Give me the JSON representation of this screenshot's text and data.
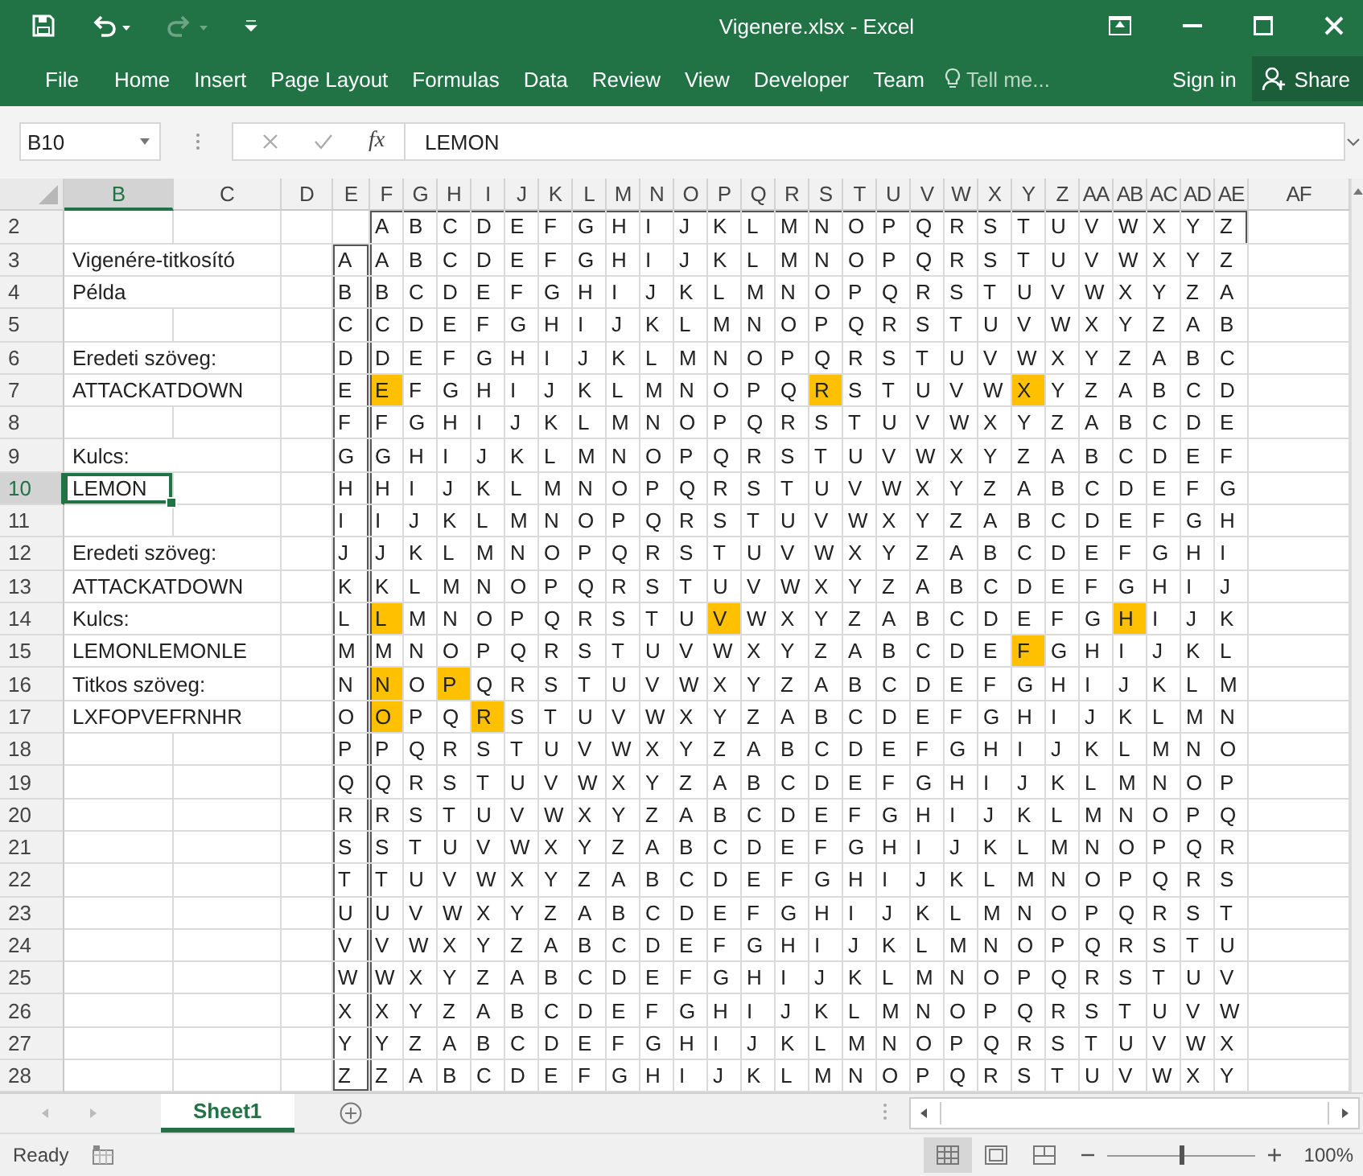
{
  "window": {
    "title": "Vigenere.xlsx - Excel"
  },
  "quick_access": [
    {
      "kind": "save",
      "disabled": false
    },
    {
      "kind": "undo",
      "disabled": false
    },
    {
      "kind": "redo",
      "disabled": true
    }
  ],
  "ribbon_tabs": [
    "File",
    "Home",
    "Insert",
    "Page Layout",
    "Formulas",
    "Data",
    "Review",
    "View",
    "Developer",
    "Team"
  ],
  "tell_me": {
    "placeholder": "Tell me..."
  },
  "sign_in": "Sign in",
  "share": "Share",
  "name_box": "B10",
  "formula_bar": {
    "fx": "fx",
    "value": "LEMON"
  },
  "columns": [
    "B",
    "C",
    "D",
    "E",
    "F",
    "G",
    "H",
    "I",
    "J",
    "K",
    "L",
    "M",
    "N",
    "O",
    "P",
    "Q",
    "R",
    "S",
    "T",
    "U",
    "V",
    "W",
    "X",
    "Y",
    "Z",
    "AA",
    "AB",
    "AC",
    "AD",
    "AE",
    "AF"
  ],
  "rows": [
    {
      "number": "2",
      "letters": [
        "A",
        "B",
        "C",
        "D",
        "E",
        "F",
        "G",
        "H",
        "I",
        "J",
        "K",
        "L",
        "M",
        "N",
        "O",
        "P",
        "Q",
        "R",
        "S",
        "T",
        "U",
        "V",
        "W",
        "X",
        "Y",
        "Z"
      ]
    },
    {
      "number": "3",
      "label": {
        "text": "Vigenére-titkosító",
        "selected": false
      },
      "key": "A",
      "letters": [
        "A",
        "B",
        "C",
        "D",
        "E",
        "F",
        "G",
        "H",
        "I",
        "J",
        "K",
        "L",
        "M",
        "N",
        "O",
        "P",
        "Q",
        "R",
        "S",
        "T",
        "U",
        "V",
        "W",
        "X",
        "Y",
        "Z"
      ]
    },
    {
      "number": "4",
      "label": {
        "text": "Példa",
        "selected": false
      },
      "key": "B",
      "letters": [
        "B",
        "C",
        "D",
        "E",
        "F",
        "G",
        "H",
        "I",
        "J",
        "K",
        "L",
        "M",
        "N",
        "O",
        "P",
        "Q",
        "R",
        "S",
        "T",
        "U",
        "V",
        "W",
        "X",
        "Y",
        "Z",
        "A"
      ]
    },
    {
      "number": "5",
      "key": "C",
      "letters": [
        "C",
        "D",
        "E",
        "F",
        "G",
        "H",
        "I",
        "J",
        "K",
        "L",
        "M",
        "N",
        "O",
        "P",
        "Q",
        "R",
        "S",
        "T",
        "U",
        "V",
        "W",
        "X",
        "Y",
        "Z",
        "A",
        "B"
      ]
    },
    {
      "number": "6",
      "label": {
        "text": "Eredeti szöveg:",
        "selected": false
      },
      "key": "D",
      "letters": [
        "D",
        "E",
        "F",
        "G",
        "H",
        "I",
        "J",
        "K",
        "L",
        "M",
        "N",
        "O",
        "P",
        "Q",
        "R",
        "S",
        "T",
        "U",
        "V",
        "W",
        "X",
        "Y",
        "Z",
        "A",
        "B",
        "C"
      ]
    },
    {
      "number": "7",
      "label": {
        "text": "ATTACKATDOWN",
        "selected": false
      },
      "key": "E",
      "letters": [
        {
          "text": "E",
          "highlighted": true
        },
        "F",
        "G",
        "H",
        "I",
        "J",
        "K",
        "L",
        "M",
        "N",
        "O",
        "P",
        "Q",
        {
          "text": "R",
          "highlighted": true
        },
        "S",
        "T",
        "U",
        "V",
        "W",
        {
          "text": "X",
          "highlighted": true
        },
        "Y",
        "Z",
        "A",
        "B",
        "C",
        "D"
      ]
    },
    {
      "number": "8",
      "key": "F",
      "letters": [
        "F",
        "G",
        "H",
        "I",
        "J",
        "K",
        "L",
        "M",
        "N",
        "O",
        "P",
        "Q",
        "R",
        "S",
        "T",
        "U",
        "V",
        "W",
        "X",
        "Y",
        "Z",
        "A",
        "B",
        "C",
        "D",
        "E"
      ]
    },
    {
      "number": "9",
      "label": {
        "text": "Kulcs:",
        "selected": false
      },
      "key": "G",
      "letters": [
        "G",
        "H",
        "I",
        "J",
        "K",
        "L",
        "M",
        "N",
        "O",
        "P",
        "Q",
        "R",
        "S",
        "T",
        "U",
        "V",
        "W",
        "X",
        "Y",
        "Z",
        "A",
        "B",
        "C",
        "D",
        "E",
        "F"
      ]
    },
    {
      "number": "10",
      "label": {
        "text": "LEMON",
        "selected": true
      },
      "key": "H",
      "letters": [
        "H",
        "I",
        "J",
        "K",
        "L",
        "M",
        "N",
        "O",
        "P",
        "Q",
        "R",
        "S",
        "T",
        "U",
        "V",
        "W",
        "X",
        "Y",
        "Z",
        "A",
        "B",
        "C",
        "D",
        "E",
        "F",
        "G"
      ]
    },
    {
      "number": "11",
      "key": "I",
      "letters": [
        "I",
        "J",
        "K",
        "L",
        "M",
        "N",
        "O",
        "P",
        "Q",
        "R",
        "S",
        "T",
        "U",
        "V",
        "W",
        "X",
        "Y",
        "Z",
        "A",
        "B",
        "C",
        "D",
        "E",
        "F",
        "G",
        "H"
      ]
    },
    {
      "number": "12",
      "label": {
        "text": "Eredeti szöveg:",
        "selected": false
      },
      "key": "J",
      "letters": [
        "J",
        "K",
        "L",
        "M",
        "N",
        "O",
        "P",
        "Q",
        "R",
        "S",
        "T",
        "U",
        "V",
        "W",
        "X",
        "Y",
        "Z",
        "A",
        "B",
        "C",
        "D",
        "E",
        "F",
        "G",
        "H",
        "I"
      ]
    },
    {
      "number": "13",
      "label": {
        "text": "ATTACKATDOWN",
        "selected": false
      },
      "key": "K",
      "letters": [
        "K",
        "L",
        "M",
        "N",
        "O",
        "P",
        "Q",
        "R",
        "S",
        "T",
        "U",
        "V",
        "W",
        "X",
        "Y",
        "Z",
        "A",
        "B",
        "C",
        "D",
        "E",
        "F",
        "G",
        "H",
        "I",
        "J"
      ]
    },
    {
      "number": "14",
      "label": {
        "text": "Kulcs:",
        "selected": false
      },
      "key": "L",
      "letters": [
        {
          "text": "L",
          "highlighted": true
        },
        "M",
        "N",
        "O",
        "P",
        "Q",
        "R",
        "S",
        "T",
        "U",
        {
          "text": "V",
          "highlighted": true
        },
        "W",
        "X",
        "Y",
        "Z",
        "A",
        "B",
        "C",
        "D",
        "E",
        "F",
        "G",
        {
          "text": "H",
          "highlighted": true
        },
        "I",
        "J",
        "K"
      ]
    },
    {
      "number": "15",
      "label": {
        "text": "LEMONLEMONLE",
        "selected": false
      },
      "key": "M",
      "letters": [
        "M",
        "N",
        "O",
        "P",
        "Q",
        "R",
        "S",
        "T",
        "U",
        "V",
        "W",
        "X",
        "Y",
        "Z",
        "A",
        "B",
        "C",
        "D",
        "E",
        {
          "text": "F",
          "highlighted": true
        },
        "G",
        "H",
        "I",
        "J",
        "K",
        "L"
      ]
    },
    {
      "number": "16",
      "label": {
        "text": "Titkos szöveg:",
        "selected": false
      },
      "key": "N",
      "letters": [
        {
          "text": "N",
          "highlighted": true
        },
        "O",
        {
          "text": "P",
          "highlighted": true
        },
        "Q",
        "R",
        "S",
        "T",
        "U",
        "V",
        "W",
        "X",
        "Y",
        "Z",
        "A",
        "B",
        "C",
        "D",
        "E",
        "F",
        "G",
        "H",
        "I",
        "J",
        "K",
        "L",
        "M"
      ]
    },
    {
      "number": "17",
      "label": {
        "text": "LXFOPVEFRNHR",
        "selected": false
      },
      "key": "O",
      "letters": [
        {
          "text": "O",
          "highlighted": true
        },
        "P",
        "Q",
        {
          "text": "R",
          "highlighted": true
        },
        "S",
        "T",
        "U",
        "V",
        "W",
        "X",
        "Y",
        "Z",
        "A",
        "B",
        "C",
        "D",
        "E",
        "F",
        "G",
        "H",
        "I",
        "J",
        "K",
        "L",
        "M",
        "N"
      ]
    },
    {
      "number": "18",
      "key": "P",
      "letters": [
        "P",
        "Q",
        "R",
        "S",
        "T",
        "U",
        "V",
        "W",
        "X",
        "Y",
        "Z",
        "A",
        "B",
        "C",
        "D",
        "E",
        "F",
        "G",
        "H",
        "I",
        "J",
        "K",
        "L",
        "M",
        "N",
        "O"
      ]
    },
    {
      "number": "19",
      "key": "Q",
      "letters": [
        "Q",
        "R",
        "S",
        "T",
        "U",
        "V",
        "W",
        "X",
        "Y",
        "Z",
        "A",
        "B",
        "C",
        "D",
        "E",
        "F",
        "G",
        "H",
        "I",
        "J",
        "K",
        "L",
        "M",
        "N",
        "O",
        "P"
      ]
    },
    {
      "number": "20",
      "key": "R",
      "letters": [
        "R",
        "S",
        "T",
        "U",
        "V",
        "W",
        "X",
        "Y",
        "Z",
        "A",
        "B",
        "C",
        "D",
        "E",
        "F",
        "G",
        "H",
        "I",
        "J",
        "K",
        "L",
        "M",
        "N",
        "O",
        "P",
        "Q"
      ]
    },
    {
      "number": "21",
      "key": "S",
      "letters": [
        "S",
        "T",
        "U",
        "V",
        "W",
        "X",
        "Y",
        "Z",
        "A",
        "B",
        "C",
        "D",
        "E",
        "F",
        "G",
        "H",
        "I",
        "J",
        "K",
        "L",
        "M",
        "N",
        "O",
        "P",
        "Q",
        "R"
      ]
    },
    {
      "number": "22",
      "key": "T",
      "letters": [
        "T",
        "U",
        "V",
        "W",
        "X",
        "Y",
        "Z",
        "A",
        "B",
        "C",
        "D",
        "E",
        "F",
        "G",
        "H",
        "I",
        "J",
        "K",
        "L",
        "M",
        "N",
        "O",
        "P",
        "Q",
        "R",
        "S"
      ]
    },
    {
      "number": "23",
      "key": "U",
      "letters": [
        "U",
        "V",
        "W",
        "X",
        "Y",
        "Z",
        "A",
        "B",
        "C",
        "D",
        "E",
        "F",
        "G",
        "H",
        "I",
        "J",
        "K",
        "L",
        "M",
        "N",
        "O",
        "P",
        "Q",
        "R",
        "S",
        "T"
      ]
    },
    {
      "number": "24",
      "key": "V",
      "letters": [
        "V",
        "W",
        "X",
        "Y",
        "Z",
        "A",
        "B",
        "C",
        "D",
        "E",
        "F",
        "G",
        "H",
        "I",
        "J",
        "K",
        "L",
        "M",
        "N",
        "O",
        "P",
        "Q",
        "R",
        "S",
        "T",
        "U"
      ]
    },
    {
      "number": "25",
      "key": "W",
      "letters": [
        "W",
        "X",
        "Y",
        "Z",
        "A",
        "B",
        "C",
        "D",
        "E",
        "F",
        "G",
        "H",
        "I",
        "J",
        "K",
        "L",
        "M",
        "N",
        "O",
        "P",
        "Q",
        "R",
        "S",
        "T",
        "U",
        "V"
      ]
    },
    {
      "number": "26",
      "key": "X",
      "letters": [
        "X",
        "Y",
        "Z",
        "A",
        "B",
        "C",
        "D",
        "E",
        "F",
        "G",
        "H",
        "I",
        "J",
        "K",
        "L",
        "M",
        "N",
        "O",
        "P",
        "Q",
        "R",
        "S",
        "T",
        "U",
        "V",
        "W"
      ]
    },
    {
      "number": "27",
      "key": "Y",
      "letters": [
        "Y",
        "Z",
        "A",
        "B",
        "C",
        "D",
        "E",
        "F",
        "G",
        "H",
        "I",
        "J",
        "K",
        "L",
        "M",
        "N",
        "O",
        "P",
        "Q",
        "R",
        "S",
        "T",
        "U",
        "V",
        "W",
        "X"
      ]
    },
    {
      "number": "28",
      "key": "Z",
      "letters": [
        "Z",
        "A",
        "B",
        "C",
        "D",
        "E",
        "F",
        "G",
        "H",
        "I",
        "J",
        "K",
        "L",
        "M",
        "N",
        "O",
        "P",
        "Q",
        "R",
        "S",
        "T",
        "U",
        "V",
        "W",
        "X",
        "Y"
      ]
    }
  ],
  "sheets": [
    {
      "name": "Sheet1",
      "selected": true
    }
  ],
  "status_bar": {
    "status": "Ready",
    "views": [
      {
        "kind": "normal",
        "selected": true
      },
      {
        "kind": "page_layout",
        "selected": false
      },
      {
        "kind": "page_break",
        "selected": false
      }
    ],
    "zoom": {
      "level": 0.5
    },
    "zoom_text": "100%"
  }
}
